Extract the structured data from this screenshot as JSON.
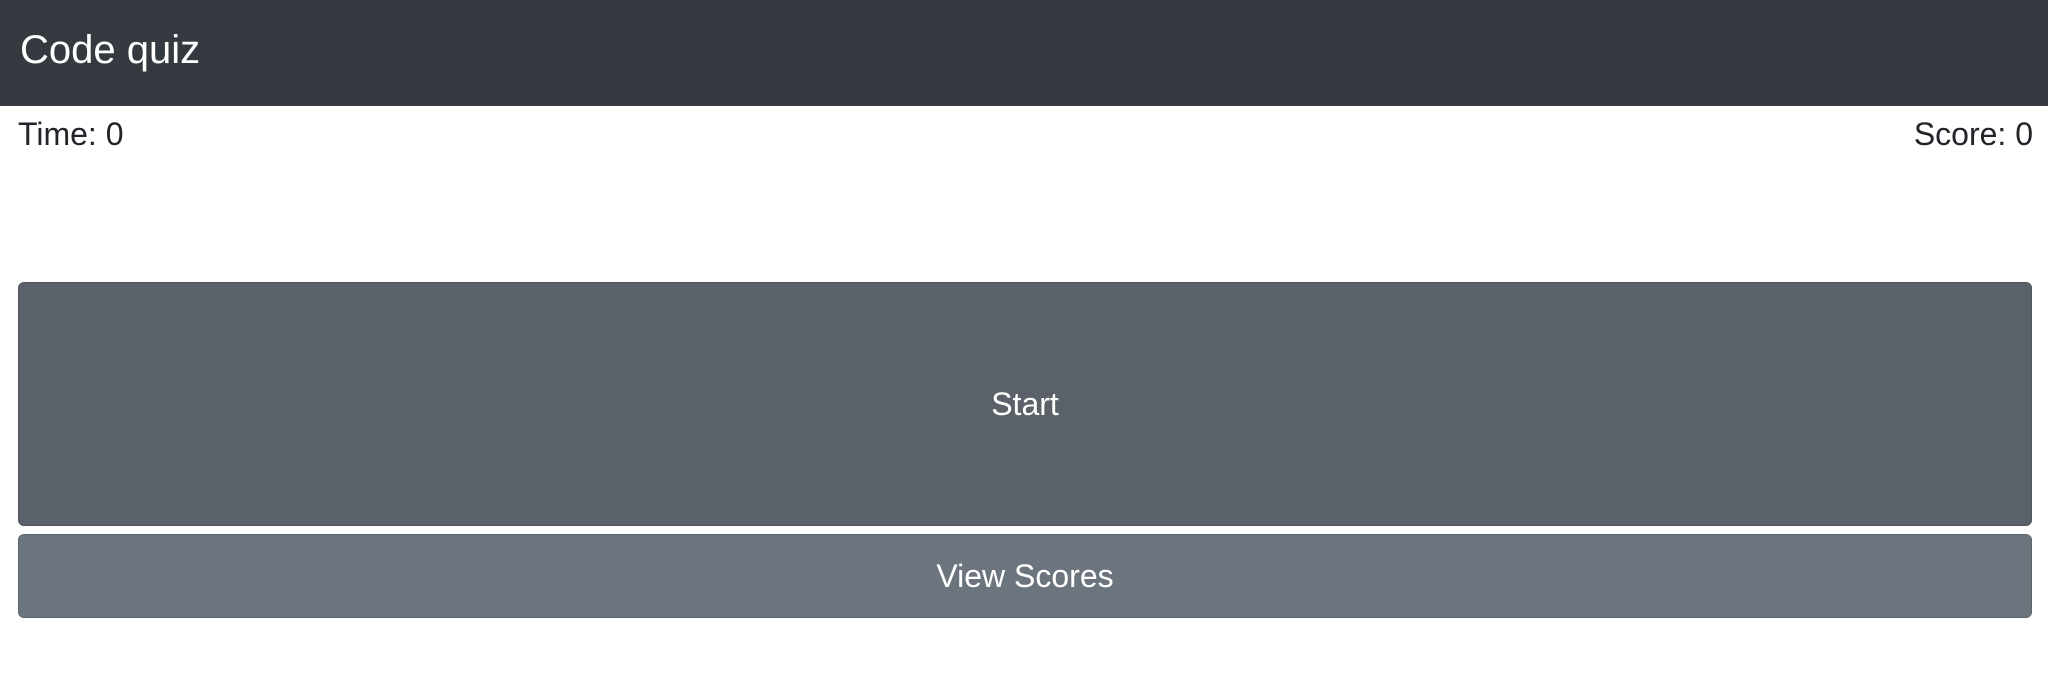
{
  "navbar": {
    "brand": "Code quiz"
  },
  "stats": {
    "time_text": "Time: 0",
    "score_text": "Score: 0"
  },
  "actions": {
    "start_label": "Start",
    "view_scores_label": "View Scores"
  },
  "colors": {
    "navbar_bg": "#343a40",
    "start_bg": "#5a6169",
    "scores_bg": "#6c757d"
  }
}
